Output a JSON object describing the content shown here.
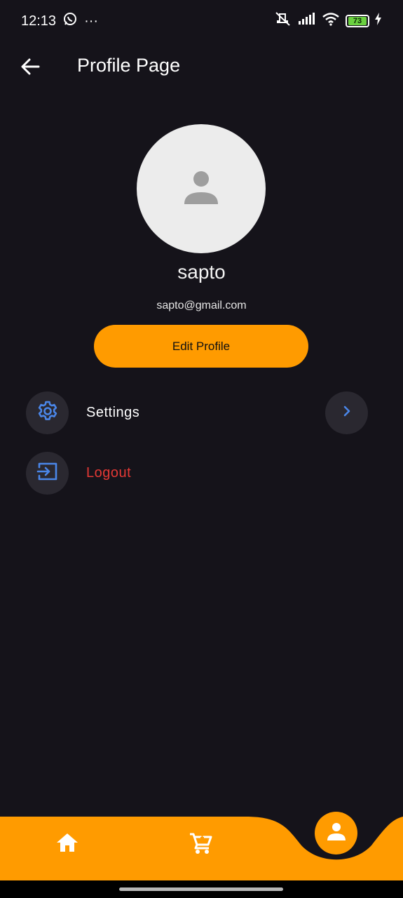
{
  "status_bar": {
    "time": "12:13",
    "more": "···",
    "battery_level": "73",
    "icons": [
      "whatsapp-icon",
      "mute-icon",
      "signal-icon",
      "wifi-icon",
      "battery-icon",
      "charging-icon"
    ]
  },
  "app_bar": {
    "back_icon": "arrow-left-icon",
    "title": "Profile Page"
  },
  "profile": {
    "avatar_icon": "person-icon",
    "name": "sapto",
    "email": "sapto@gmail.com",
    "edit_button": "Edit Profile"
  },
  "menu": {
    "settings": {
      "label": "Settings",
      "icon": "gear-icon",
      "chevron": "chevron-right-icon"
    },
    "logout": {
      "label": "Logout",
      "icon": "logout-icon"
    }
  },
  "bottom_nav": {
    "items": [
      {
        "icon": "home-icon"
      },
      {
        "icon": "cart-icon"
      },
      {
        "icon": "person-icon",
        "active": true
      }
    ]
  },
  "colors": {
    "background": "#15131a",
    "accent": "#ff9b00",
    "icon_blue": "#4a86e8",
    "logout_red": "#e53935",
    "tile": "#2a2830"
  }
}
